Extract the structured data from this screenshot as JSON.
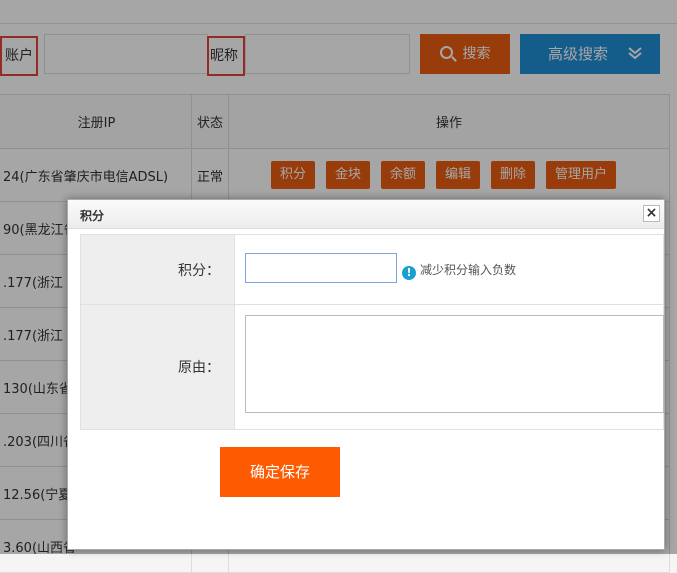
{
  "filter": {
    "account_label": "账户",
    "nickname_label": "昵称",
    "search_label": "搜索",
    "advanced_label": "高级搜索"
  },
  "table": {
    "headers": {
      "ip": "注册IP",
      "status": "状态",
      "ops": "操作"
    },
    "rows": [
      {
        "ip": "24(广东省肇庆市电信ADSL)",
        "status": "正常"
      },
      {
        "ip": "90(黑龙江省"
      },
      {
        "ip": ".177(浙江"
      },
      {
        "ip": ".177(浙江"
      },
      {
        "ip": "130(山东省"
      },
      {
        "ip": ".203(四川省"
      },
      {
        "ip": "12.56(宁夏"
      },
      {
        "ip": "3.60(山西省"
      }
    ],
    "actions": [
      "积分",
      "金块",
      "余额",
      "编辑",
      "删除",
      "管理用户"
    ]
  },
  "dialog": {
    "title": "积分",
    "close": "×",
    "points_label": "积分：",
    "points_value": "",
    "hint_icon": "!",
    "hint": "减少积分输入负数",
    "reason_label": "原由：",
    "reason_value": "",
    "save_label": "确定保存"
  }
}
